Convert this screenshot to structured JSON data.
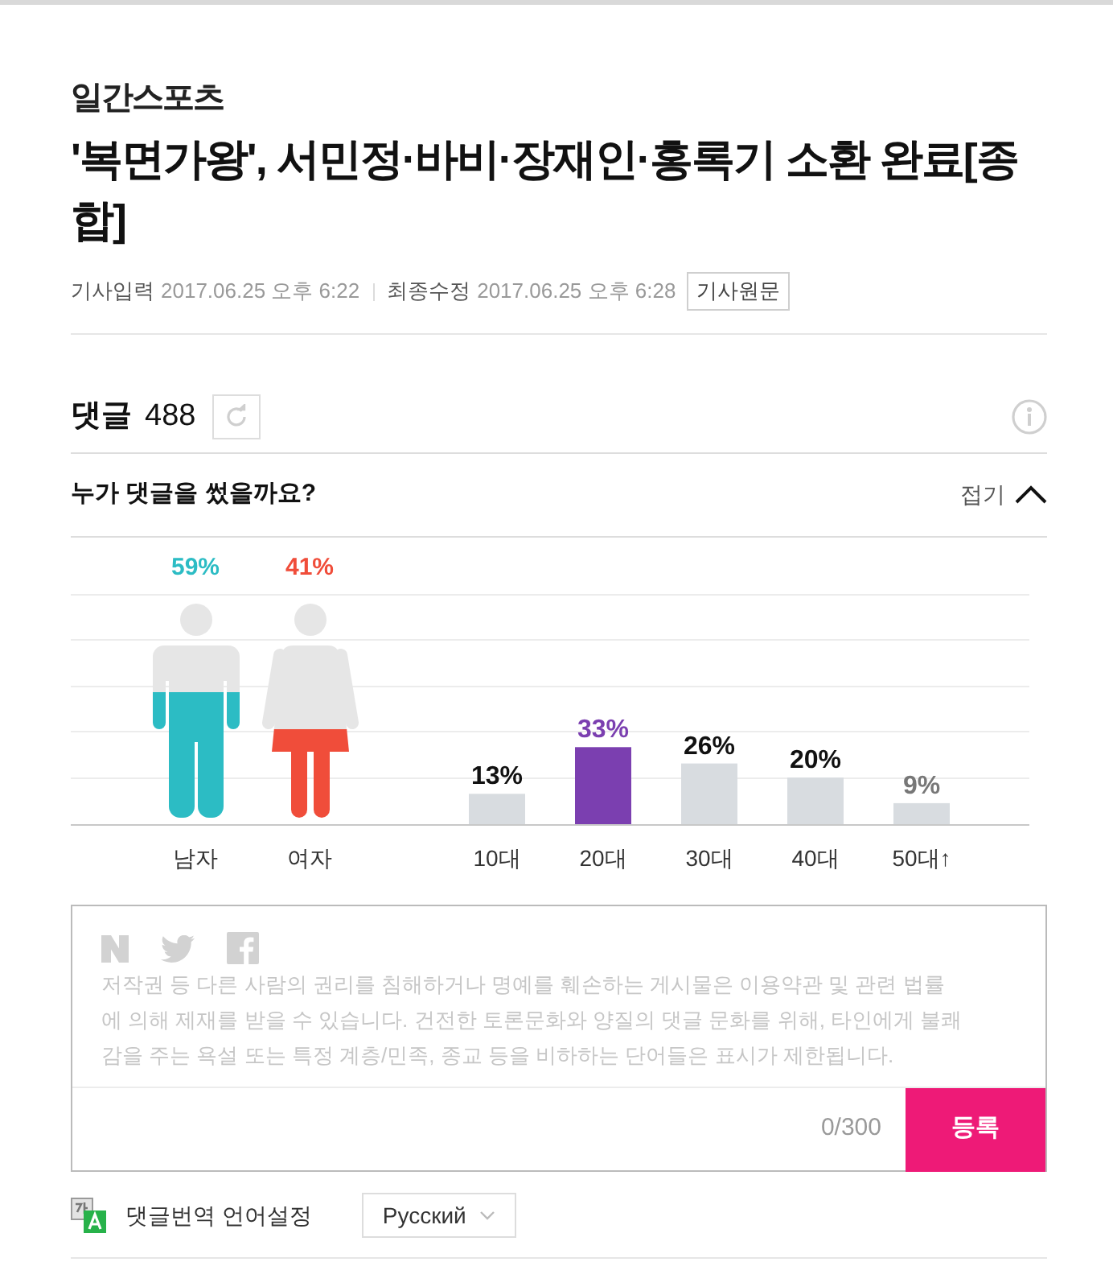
{
  "logo": {
    "text": "일간스포츠"
  },
  "article": {
    "title": "'복면가왕', 서민정·바비·장재인·홍록기 소환 완료[종합]",
    "timestamps": [
      {
        "label": "기사입력",
        "value": "2017.06.25 오후 6:22"
      },
      {
        "label": "최종수정",
        "value": "2017.06.25 오후 6:28"
      }
    ],
    "source_button": "기사원문"
  },
  "comments": {
    "title": "댓글",
    "count": "488"
  },
  "demographics": {
    "title": "누가 댓글을 썼을까요?",
    "toggle": "접기",
    "expanded": true,
    "gender": [
      {
        "kind": "male",
        "label": "남자",
        "reading": "59%",
        "level": 0.59,
        "color": "#2cbcc4"
      },
      {
        "kind": "female",
        "label": "여자",
        "reading": "41%",
        "level": 0.41,
        "color": "#f04d3a"
      }
    ],
    "age": {
      "chart_data": {
        "type": "bar",
        "categories": [
          "10대",
          "20대",
          "30대",
          "40대",
          "50대↑"
        ],
        "values": [
          13,
          33,
          26,
          20,
          9
        ],
        "value_labels": [
          "13%",
          "33%",
          "26%",
          "20%",
          "9%"
        ]
      }
    }
  },
  "comment_box": {
    "placeholder": "저작권 등 다른 사람의 권리를 침해하거나 명예를 훼손하는 게시물은 이용약관 및 관련 법률에 의해 제재를 받을 수 있습니다. 건전한 토론문화와 양질의 댓글 문화를 위해, 타인에게 불쾌감을 주는 욕설 또는 특정 계층/민족, 종교 등을 비하하는 단어들은 표시가 제한됩니다.",
    "counter": "0/300",
    "submit": "등록"
  },
  "translation": {
    "label": "댓글번역 언어설정",
    "language": "Русский"
  }
}
